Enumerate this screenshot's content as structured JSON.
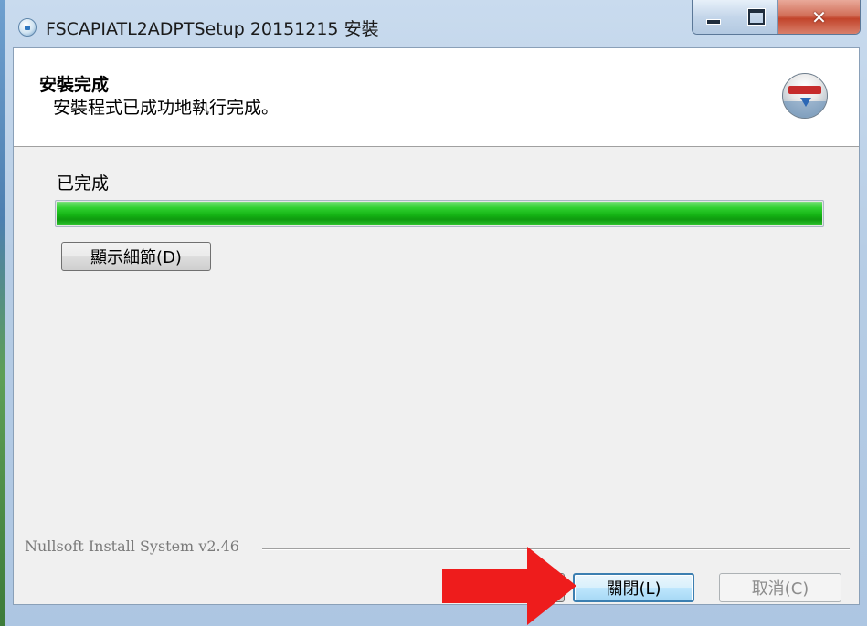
{
  "window": {
    "title": "FSCAPIATL2ADPTSetup 20151215 安裝"
  },
  "header": {
    "title": "安裝完成",
    "subtitle": "安裝程式已成功地執行完成。"
  },
  "progress": {
    "status_label": "已完成",
    "value": 1.0,
    "color": "#16b816"
  },
  "buttons": {
    "show_details": "顯示細節(D)",
    "back": "",
    "close": "關閉(L)",
    "cancel": "取消(C)"
  },
  "footer": {
    "brand": "Nullsoft Install System v2.46"
  },
  "icons": {
    "title_icon": "installer-icon",
    "header_logo": "nsis-logo-icon",
    "annotation": "red-arrow-icon"
  },
  "colors": {
    "annotation_arrow": "#ee1c1c",
    "default_button_border": "#3c7fb1"
  }
}
